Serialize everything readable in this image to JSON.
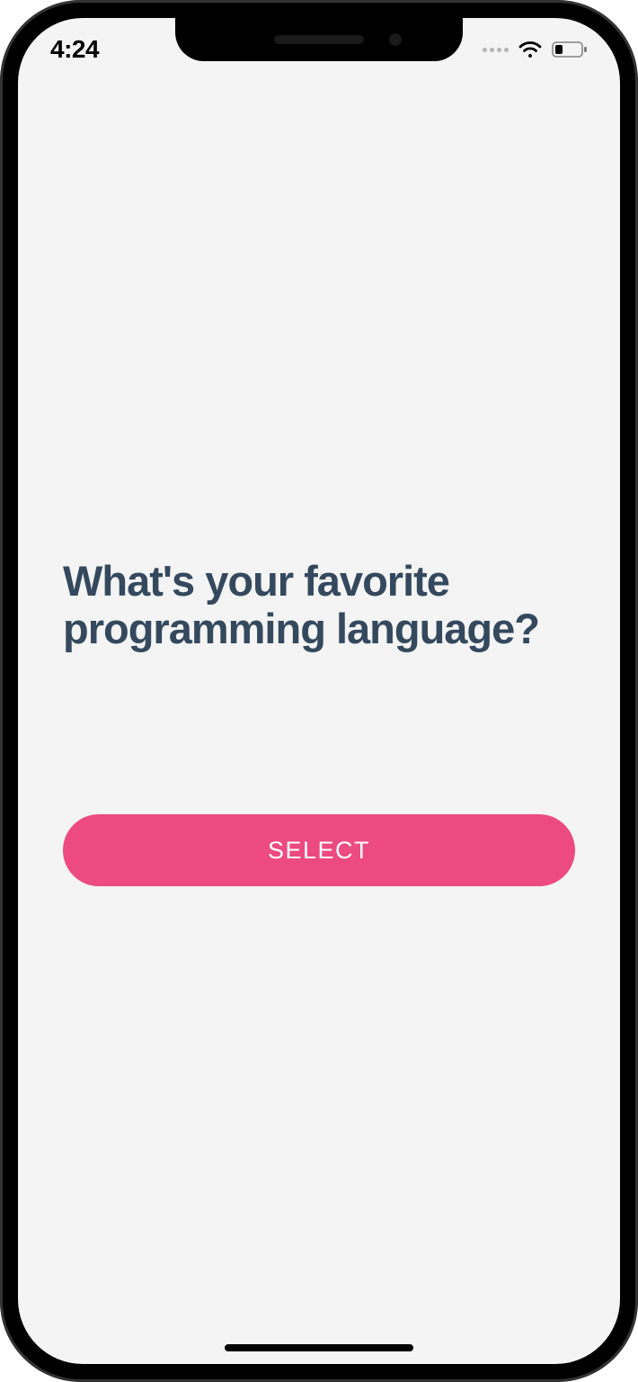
{
  "status": {
    "time": "4:24"
  },
  "content": {
    "question_title": "What's your favorite programming language?",
    "select_button_label": "SELECT"
  },
  "colors": {
    "title": "#34495e",
    "button_bg": "#ed4a82",
    "screen_bg": "#f4f4f4"
  }
}
